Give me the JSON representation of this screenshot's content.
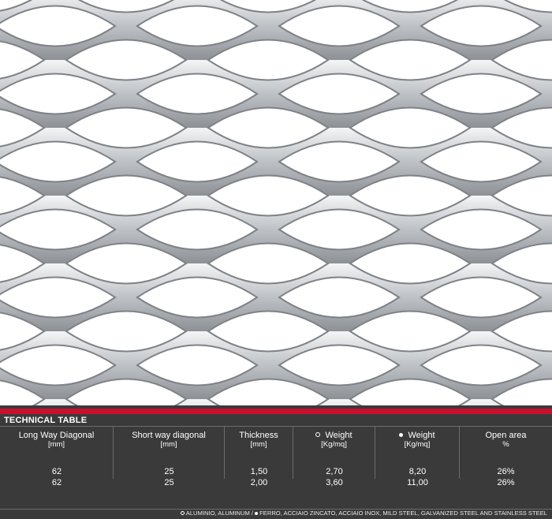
{
  "table": {
    "title": "TECHNICAL TABLE",
    "columns": [
      {
        "label": "Long Way Diagonal",
        "unit": "[mm]",
        "bullet": ""
      },
      {
        "label": "Short way diagonal",
        "unit": "[mm]",
        "bullet": ""
      },
      {
        "label": "Thickness",
        "unit": "[mm]",
        "bullet": ""
      },
      {
        "label": "Weight",
        "unit": "[Kg/mq]",
        "bullet": "open"
      },
      {
        "label": "Weight",
        "unit": "[Kg/mq]",
        "bullet": "solid"
      },
      {
        "label": "Open area",
        "unit": "%",
        "bullet": ""
      }
    ],
    "rows": [
      [
        "62",
        "25",
        "1,50",
        "2,70",
        "8,20",
        "26%"
      ],
      [
        "62",
        "25",
        "2,00",
        "3,60",
        "11,00",
        "26%"
      ]
    ]
  },
  "legend": {
    "aluminium": "ALUMINIO, ALUMINUM /",
    "steel": "FERRO, ACCIAIO ZINCATO, ACCIAIO INOX, MILD STEEL, GALVANIZED STEEL AND STAINLESS STEEL"
  },
  "colors": {
    "accent": "#c8102e",
    "panel": "#3a3a3b",
    "metal": "#c9ccd0"
  }
}
